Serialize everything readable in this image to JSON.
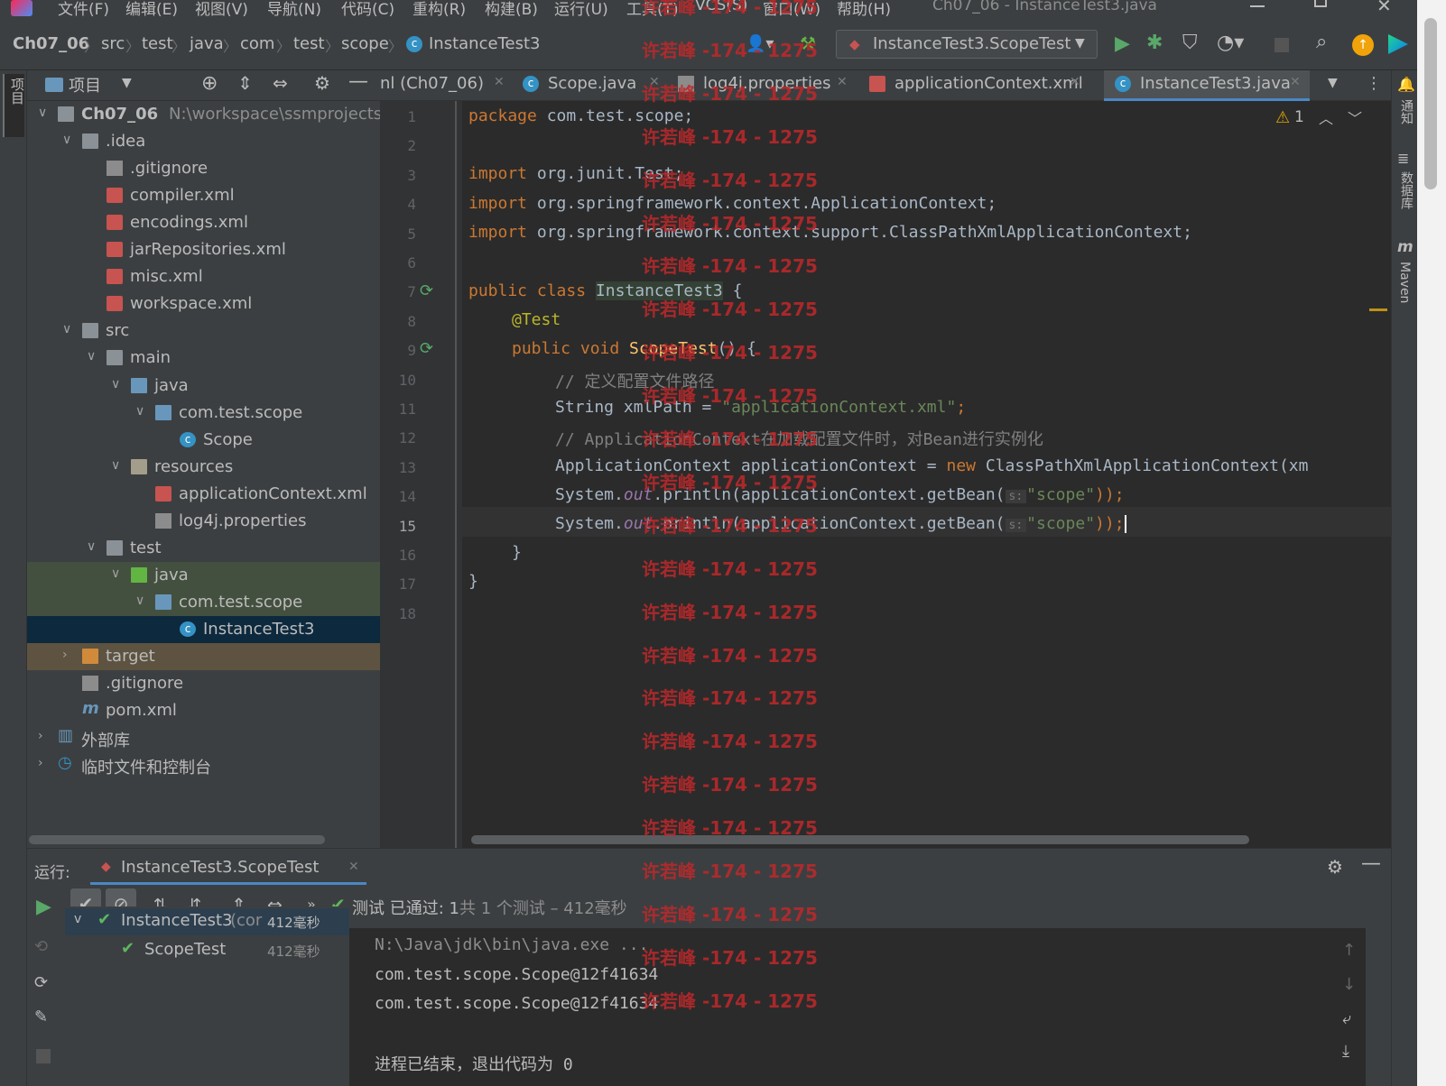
{
  "menu": [
    "文件(F)",
    "编辑(E)",
    "视图(V)",
    "导航(N)",
    "代码(C)",
    "重构(R)",
    "构建(B)",
    "运行(U)",
    "工具(T)",
    "VCS(S)",
    "窗口(W)",
    "帮助(H)"
  ],
  "window_title": "Ch07_06 - InstanceTest3.java",
  "breadcrumb": [
    "Ch07_06",
    "src",
    "test",
    "java",
    "com",
    "test",
    "scope",
    "InstanceTest3"
  ],
  "run_config": "InstanceTest3.ScopeTest",
  "left_strip_label": "项目",
  "project_panel": {
    "title": "项目",
    "tree": [
      {
        "label": "Ch07_06",
        "extra": "N:\\workspace\\ssmprojects\\C",
        "icon": "module-folder-icon",
        "arrow": "v",
        "depth": 0
      },
      {
        "label": ".idea",
        "icon": "folder-icon",
        "arrow": "v",
        "depth": 1
      },
      {
        "label": ".gitignore",
        "icon": "gitignore-file-icon",
        "arrow": "",
        "depth": 2
      },
      {
        "label": "compiler.xml",
        "icon": "xml-file-icon",
        "arrow": "",
        "depth": 2
      },
      {
        "label": "encodings.xml",
        "icon": "xml-file-icon",
        "arrow": "",
        "depth": 2
      },
      {
        "label": "jarRepositories.xml",
        "icon": "xml-file-icon",
        "arrow": "",
        "depth": 2
      },
      {
        "label": "misc.xml",
        "icon": "xml-file-icon",
        "arrow": "",
        "depth": 2
      },
      {
        "label": "workspace.xml",
        "icon": "xml-file-icon",
        "arrow": "",
        "depth": 2
      },
      {
        "label": "src",
        "icon": "folder-icon",
        "arrow": "v",
        "depth": 1
      },
      {
        "label": "main",
        "icon": "folder-icon",
        "arrow": "v",
        "depth": 2
      },
      {
        "label": "java",
        "icon": "source-folder-icon",
        "arrow": "v",
        "depth": 3
      },
      {
        "label": "com.test.scope",
        "icon": "package-icon",
        "arrow": "v",
        "depth": 4
      },
      {
        "label": "Scope",
        "icon": "class-icon",
        "arrow": "",
        "depth": 5
      },
      {
        "label": "resources",
        "icon": "resources-folder-icon",
        "arrow": "v",
        "depth": 3
      },
      {
        "label": "applicationContext.xml",
        "icon": "xml-file-icon",
        "arrow": "",
        "depth": 4
      },
      {
        "label": "log4j.properties",
        "icon": "properties-file-icon",
        "arrow": "",
        "depth": 4
      },
      {
        "label": "test",
        "icon": "folder-icon",
        "arrow": "v",
        "depth": 2
      },
      {
        "label": "java",
        "icon": "test-folder-icon",
        "arrow": "v",
        "depth": 3
      },
      {
        "label": "com.test.scope",
        "icon": "package-icon",
        "arrow": "v",
        "depth": 4
      },
      {
        "label": "InstanceTest3",
        "icon": "test-class-icon",
        "arrow": "",
        "depth": 5
      },
      {
        "label": "target",
        "icon": "excluded-folder-icon",
        "arrow": ">",
        "depth": 1
      },
      {
        "label": ".gitignore",
        "icon": "gitignore-file-icon",
        "arrow": "",
        "depth": 1
      },
      {
        "label": "pom.xml",
        "icon": "maven-icon",
        "arrow": "",
        "depth": 1
      },
      {
        "label": "外部库",
        "icon": "library-icon",
        "arrow": ">",
        "depth": 0
      },
      {
        "label": "临时文件和控制台",
        "icon": "scratch-icon",
        "arrow": ">",
        "depth": 0
      }
    ]
  },
  "editor_tabs": [
    {
      "label": "nl (Ch07_06)",
      "icon": ""
    },
    {
      "label": "Scope.java",
      "icon": "class-icon"
    },
    {
      "label": "log4j.properties",
      "icon": "properties-file-icon"
    },
    {
      "label": "applicationContext.xml",
      "icon": "xml-file-icon"
    },
    {
      "label": "InstanceTest3.java",
      "icon": "class-icon",
      "active": true
    }
  ],
  "warning_count": "1",
  "line_numbers": [
    "1",
    "2",
    "3",
    "4",
    "5",
    "6",
    "7",
    "8",
    "9",
    "10",
    "11",
    "12",
    "13",
    "14",
    "15",
    "16",
    "17",
    "18"
  ],
  "code": {
    "l1_kw": "package",
    "l1_rest": " com.test.scope;",
    "l3_kw": "import",
    "l3_rest": " org.junit.Test;",
    "l4_kw": "import",
    "l4_rest": " org.springframework.context.ApplicationContext;",
    "l5_kw": "import",
    "l5_rest": " org.springframework.context.support.ClassPathXmlApplicationContext;",
    "l7_kw": "public class ",
    "l7_name": "InstanceTest3",
    "l7_rest": " {",
    "l8_an": "@Test",
    "l9_kw": "public void ",
    "l9_fn": "ScopeTest",
    "l9_rest": "() {",
    "l10_cm": "// 定义配置文件路径",
    "l11_a": "String xmlPath = ",
    "l11_str": "\"applicationContext.xml\"",
    "l11_b": ";",
    "l12_cm": "// ApplicationContext在加载配置文件时，对Bean进行实例化",
    "l13_a": "ApplicationContext applicationContext = ",
    "l13_kw": "new",
    "l13_b": " ClassPathXmlApplicationContext(xm",
    "l14_a": "System.",
    "l14_fld": "out",
    "l14_b": ".println(applicationContext.getBean(",
    "l14_hint": "s:",
    "l14_str": "\"scope\"",
    "l14_c": "));",
    "l15_a": "System.",
    "l15_fld": "out",
    "l15_b": ".println(applicationContext.getBean(",
    "l15_hint": "s:",
    "l15_str": "\"scope\"",
    "l15_c": "));",
    "l16": "}",
    "l17": "}"
  },
  "right_strip": [
    "通知",
    "数据库",
    "Maven"
  ],
  "run_panel": {
    "label": "运行:",
    "tab": "InstanceTest3.ScopeTest",
    "status_prefix": "测试 已通过: ",
    "status_count": "1",
    "status_suffix": "共 1 个测试 – 412毫秒",
    "tree": [
      {
        "label": "InstanceTest3",
        "extra": "(cor",
        "time": "412毫秒"
      },
      {
        "label": "ScopeTest",
        "time": "412毫秒"
      }
    ],
    "console": [
      "N:\\Java\\jdk\\bin\\java.exe ...",
      "com.test.scope.Scope@12f41634",
      "com.test.scope.Scope@12f41634",
      "",
      "进程已结束，退出代码为 0"
    ]
  },
  "watermark": "许若峰 -174 - 1275",
  "colors": {
    "keyword": "#cc7832",
    "string": "#6a8759",
    "comment": "#808080",
    "annotation": "#bbb529",
    "selection": "#0d293e",
    "pass": "#5fb65f",
    "watermark": "#c0282a"
  }
}
